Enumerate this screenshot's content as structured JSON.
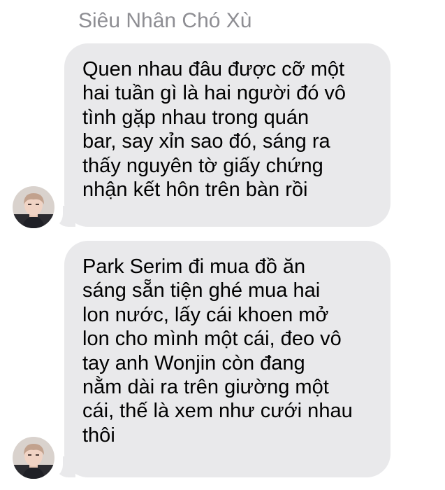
{
  "conversation": {
    "sender_name": "Siêu Nhân Chó Xù"
  },
  "messages": [
    {
      "text": "Quen nhau đâu được cỡ một\nhai tuần gì là hai người đó vô\ntình gặp nhau trong quán\nbar, say xỉn sao đó, sáng ra\nthấy nguyên tờ giấy chứng\nnhận kết hôn trên bàn rồi"
    },
    {
      "text": "Park Serim đi mua đồ ăn\nsáng sẵn tiện ghé mua hai\nlon nước, lấy cái khoen mở\nlon cho mình một cái, đeo vô\ntay anh Wonjin còn đang\nnằm dài ra trên giường một\ncái, thế là xem như cưới nhau\nthôi"
    }
  ],
  "colors": {
    "bubble": "#e9e9eb",
    "sender_name": "#8e8e93",
    "text": "#000000"
  },
  "icons": {
    "avatar": "user-avatar-photo"
  }
}
